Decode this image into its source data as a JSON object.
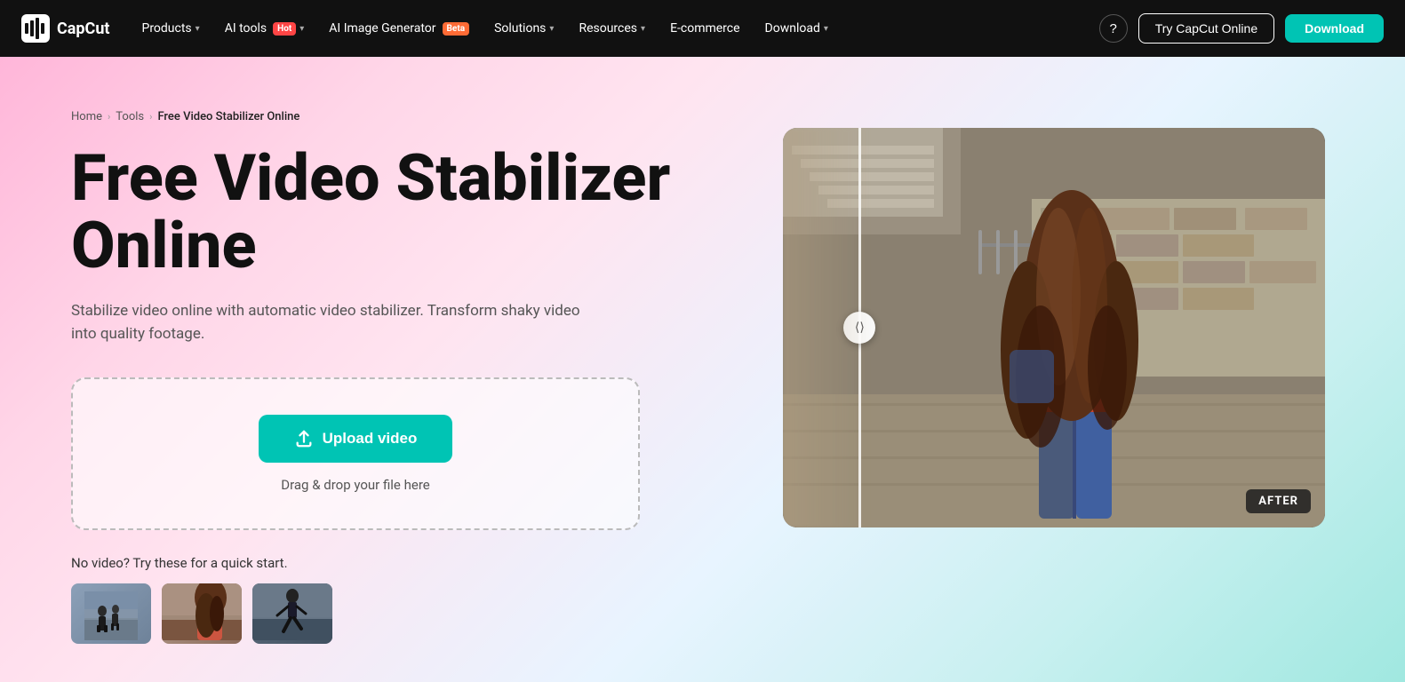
{
  "brand": {
    "name": "CapCut",
    "logo_alt": "CapCut logo"
  },
  "nav": {
    "items": [
      {
        "label": "Products",
        "has_dropdown": true,
        "badge": null
      },
      {
        "label": "AI tools",
        "has_dropdown": true,
        "badge": "Hot"
      },
      {
        "label": "AI Image Generator",
        "has_dropdown": false,
        "badge": "Beta"
      },
      {
        "label": "Solutions",
        "has_dropdown": true,
        "badge": null
      },
      {
        "label": "Resources",
        "has_dropdown": true,
        "badge": null
      },
      {
        "label": "E-commerce",
        "has_dropdown": false,
        "badge": null
      },
      {
        "label": "Download",
        "has_dropdown": true,
        "badge": null
      }
    ],
    "help_label": "?",
    "try_online_label": "Try CapCut Online",
    "download_label": "Download"
  },
  "breadcrumb": {
    "items": [
      {
        "label": "Home",
        "active": false
      },
      {
        "label": "Tools",
        "active": false
      },
      {
        "label": "Free Video Stabilizer Online",
        "active": true
      }
    ]
  },
  "hero": {
    "title": "Free Video Stabilizer Online",
    "subtitle": "Stabilize video online with automatic video stabilizer. Transform shaky video into quality footage.",
    "upload_btn_label": "Upload video",
    "drag_drop_label": "Drag & drop your file here",
    "quick_start_label": "No video? Try these for a quick start.",
    "preview_after_label": "AFTER",
    "slider_icon": "⟨ ⟩"
  }
}
